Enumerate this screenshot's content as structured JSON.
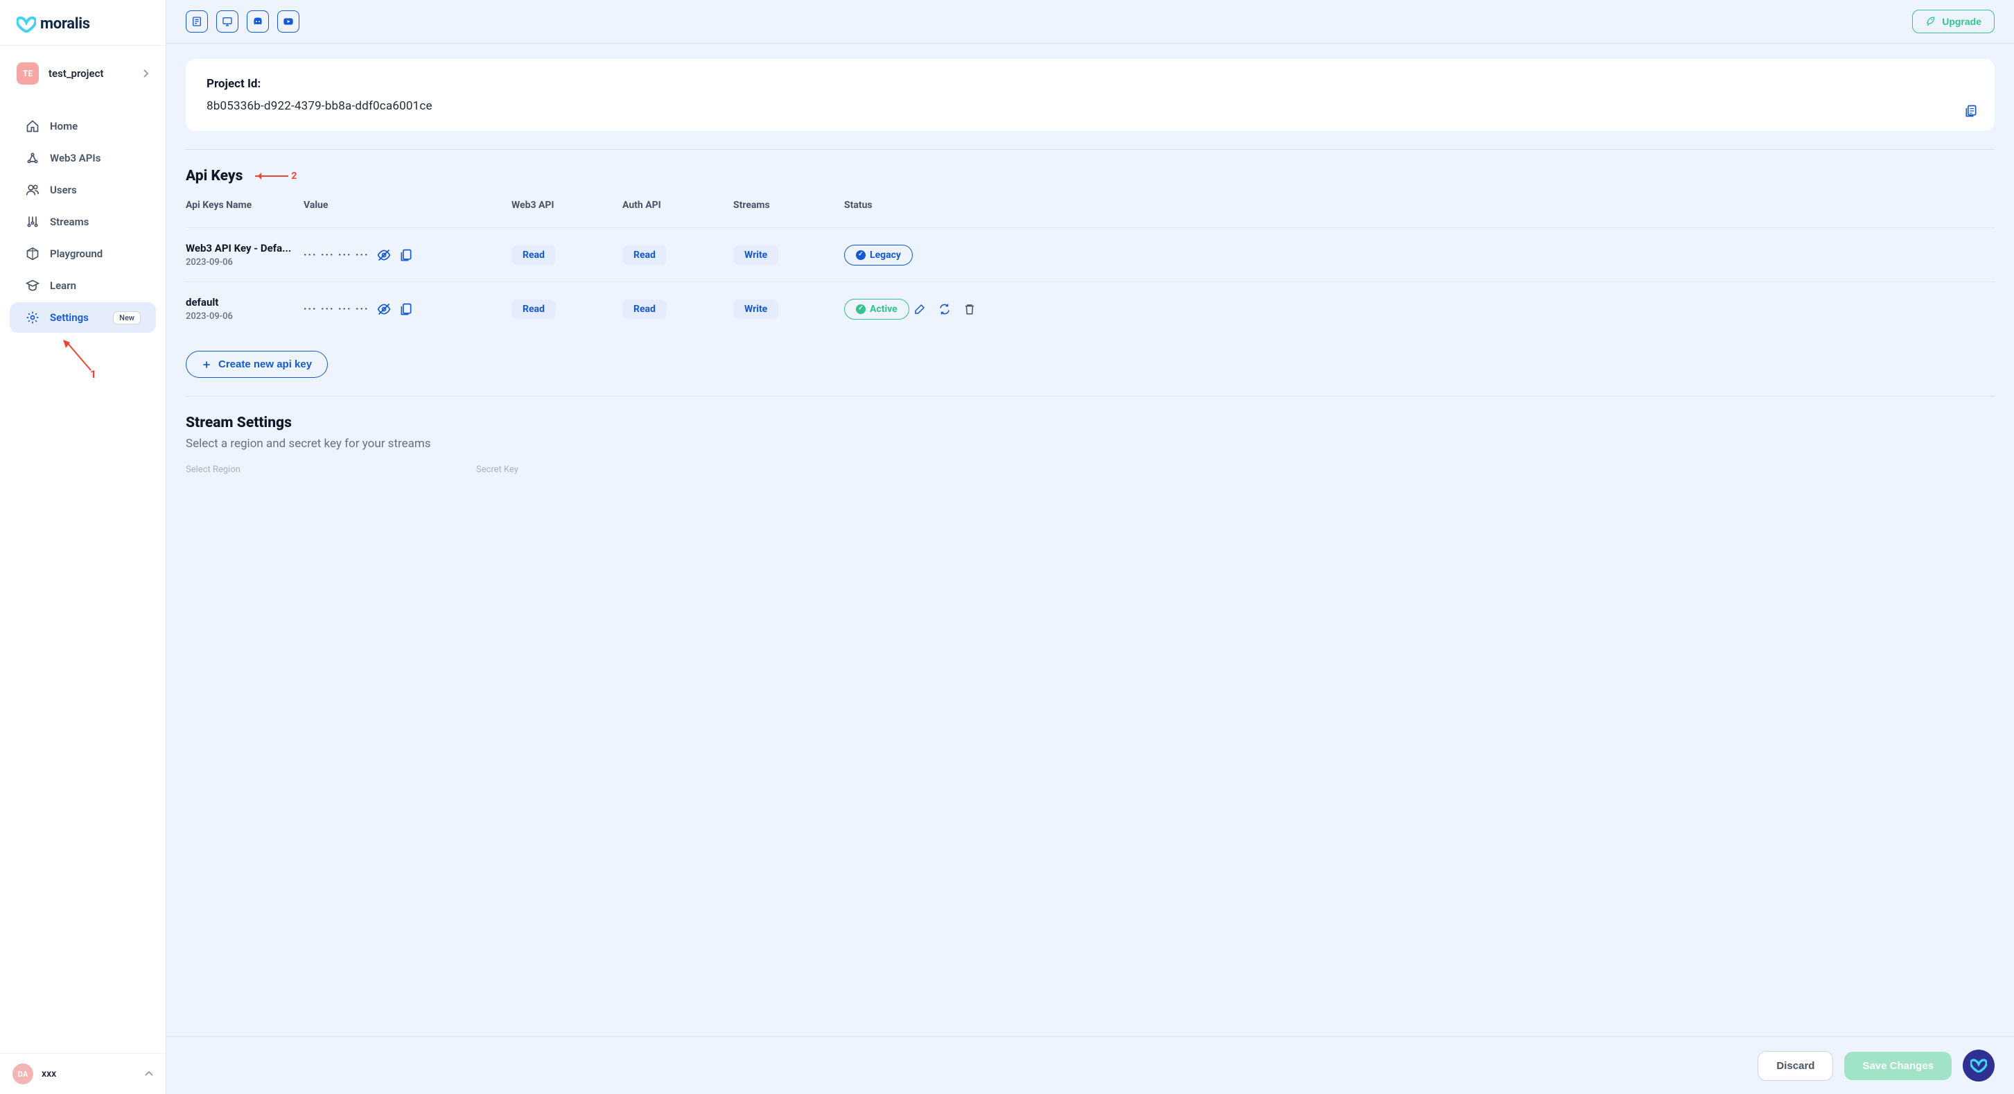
{
  "brand": {
    "name": "moralis"
  },
  "project": {
    "badge": "TE",
    "name": "test_project"
  },
  "nav": {
    "home": "Home",
    "web3apis": "Web3 APIs",
    "users": "Users",
    "streams": "Streams",
    "playground": "Playground",
    "learn": "Learn",
    "settings": "Settings",
    "settings_tag": "New"
  },
  "user": {
    "badge": "DA",
    "name": "xxx"
  },
  "topbar": {
    "upgrade": "Upgrade"
  },
  "projectId": {
    "label": "Project Id:",
    "value": "8b05336b-d922-4379-bb8a-ddf0ca6001ce"
  },
  "apiKeys": {
    "title": "Api Keys",
    "columns": {
      "name": "Api Keys Name",
      "value": "Value",
      "web3": "Web3 API",
      "auth": "Auth API",
      "streams": "Streams",
      "status": "Status"
    },
    "rows": [
      {
        "name": "Web3 API Key - Defa...",
        "date": "2023-09-06",
        "masked": "···   ···   ···   ···",
        "web3": "Read",
        "auth": "Read",
        "streams": "Write",
        "status": "Legacy",
        "status_kind": "legacy"
      },
      {
        "name": "default",
        "date": "2023-09-06",
        "masked": "···   ···   ···   ···",
        "web3": "Read",
        "auth": "Read",
        "streams": "Write",
        "status": "Active",
        "status_kind": "active"
      }
    ],
    "create": "Create new api key"
  },
  "streamSettings": {
    "title": "Stream Settings",
    "desc": "Select a region and secret key for your streams",
    "region_label": "Select Region",
    "secret_label": "Secret Key"
  },
  "footer": {
    "discard": "Discard",
    "save": "Save Changes"
  },
  "annotations": {
    "a1": "1",
    "a2": "2"
  }
}
